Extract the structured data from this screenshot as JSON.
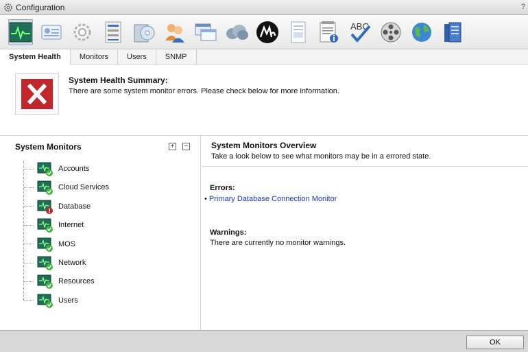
{
  "window": {
    "title": "Configuration",
    "help": "?"
  },
  "toolbar": {
    "icons": [
      "system-health",
      "user-card",
      "gear",
      "server-rack",
      "disc-stack",
      "users",
      "windows",
      "cloud",
      "m-logo",
      "document",
      "notepad-info",
      "spellcheck",
      "film-reel",
      "globe",
      "server-blocks"
    ],
    "spellcheck_text": "ABC"
  },
  "tabs": [
    "System Health",
    "Monitors",
    "Users",
    "SNMP"
  ],
  "summary": {
    "title": "System Health Summary:",
    "message": "There are some system monitor errors. Please check below for more information."
  },
  "monitors": {
    "title": "System Monitors",
    "expand_symbol": "+",
    "collapse_symbol": "−",
    "items": [
      {
        "label": "Accounts",
        "status": "ok"
      },
      {
        "label": "Cloud Services",
        "status": "ok"
      },
      {
        "label": "Database",
        "status": "error"
      },
      {
        "label": "Internet",
        "status": "ok"
      },
      {
        "label": "MOS",
        "status": "ok"
      },
      {
        "label": "Network",
        "status": "ok"
      },
      {
        "label": "Resources",
        "status": "ok"
      },
      {
        "label": "Users",
        "status": "ok"
      }
    ]
  },
  "overview": {
    "title": "System Monitors Overview",
    "subtitle": "Take a look below to see what monitors may be in a errored state.",
    "errors_heading": "Errors:",
    "errors": [
      "Primary Database Connection Monitor"
    ],
    "warnings_heading": "Warnings:",
    "warnings_text": "There are currently no monitor warnings."
  },
  "footer": {
    "ok_label": "OK"
  },
  "colors": {
    "error": "#c0262b",
    "ok": "#3fb33a",
    "link": "#1a35c6",
    "monitor_screen": "#1f6f57"
  }
}
